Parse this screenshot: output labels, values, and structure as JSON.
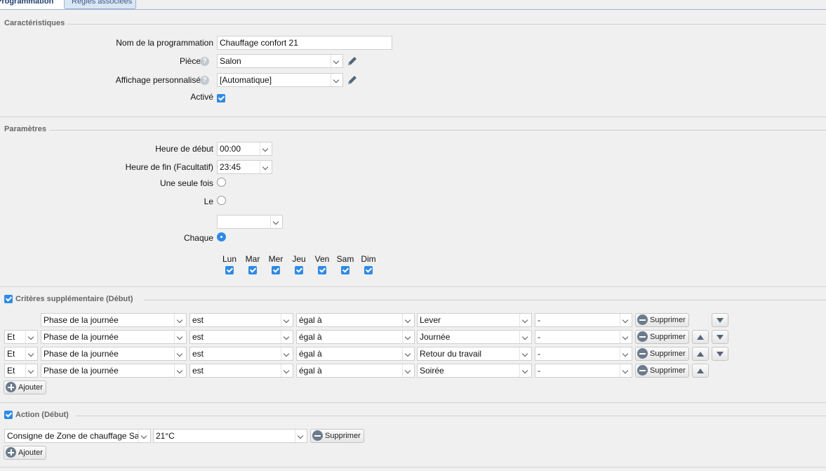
{
  "tabs": {
    "active": "Programmation",
    "inactive": "Règles associées"
  },
  "caracteristiques": {
    "title": "Caractéristiques",
    "nom_label": "Nom de la programmation",
    "nom_value": "Chauffage confort 21",
    "piece_label": "Pièce",
    "piece_value": "Salon",
    "affichage_label": "Affichage personnalisé",
    "affichage_value": "[Automatique]",
    "active_label": "Activé",
    "active_checked": true
  },
  "parametres": {
    "title": "Paramètres",
    "debut_label": "Heure de début",
    "debut_value": "00:00",
    "fin_label": "Heure de fin (Facultatif)",
    "fin_value": "23:45",
    "une_fois_label": "Une seule fois",
    "le_label": "Le",
    "le_value": "",
    "chaque_label": "Chaque",
    "days": [
      "Lun",
      "Mar",
      "Mer",
      "Jeu",
      "Ven",
      "Sam",
      "Dim"
    ]
  },
  "criteres": {
    "title": "Critères supplémentaire (Début)",
    "rows": [
      {
        "op": "",
        "field": "Phase de la journée",
        "verb": "est",
        "cmp": "égal à",
        "value": "Lever",
        "extra": "-",
        "delete": "Supprimer"
      },
      {
        "op": "Et",
        "field": "Phase de la journée",
        "verb": "est",
        "cmp": "égal à",
        "value": "Journée",
        "extra": "-",
        "delete": "Supprimer"
      },
      {
        "op": "Et",
        "field": "Phase de la journée",
        "verb": "est",
        "cmp": "égal à",
        "value": "Retour du travail",
        "extra": "-",
        "delete": "Supprimer"
      },
      {
        "op": "Et",
        "field": "Phase de la journée",
        "verb": "est",
        "cmp": "égal à",
        "value": "Soirée",
        "extra": "-",
        "delete": "Supprimer"
      }
    ],
    "add_label": "Ajouter"
  },
  "action": {
    "title": "Action (Début)",
    "target": "Consigne de Zone de chauffage Salon",
    "value": "21°C",
    "delete": "Supprimer",
    "add_label": "Ajouter"
  },
  "colors": {
    "accent": "#2f8ae5",
    "tab_border": "#9bb4d6",
    "icon": "#56667a"
  }
}
